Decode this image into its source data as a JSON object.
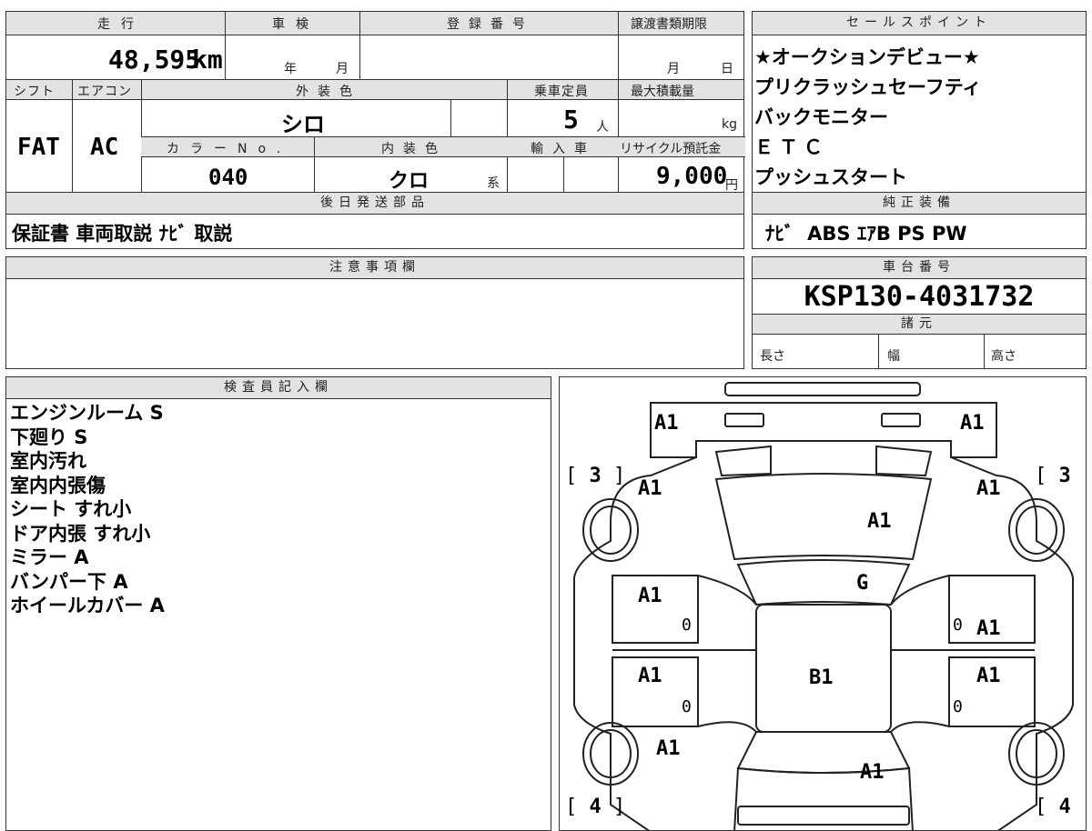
{
  "main": {
    "mileage_label": "走行",
    "mileage_value": "48,595",
    "mileage_unit": "km",
    "inspection_label": "車検",
    "inspection_year": "年",
    "inspection_month": "月",
    "registration_label": "登録番号",
    "transfer_label": "譲渡書類期限",
    "transfer_month": "月",
    "transfer_day": "日",
    "shift_label": "シフト",
    "shift_value": "FAT",
    "ac_label": "エアコン",
    "ac_value": "AC",
    "exterior_color_label": "外装色",
    "exterior_color_value": "シロ",
    "capacity_label": "乗車定員",
    "capacity_value": "5",
    "capacity_unit": "人",
    "max_load_label": "最大積載量",
    "max_load_unit": "kg",
    "color_no_label": "カラーNo.",
    "color_no_value": "040",
    "interior_color_label": "内装色",
    "interior_color_value": "クロ",
    "interior_color_suffix": "系",
    "import_label": "輸入車",
    "recycle_label": "リサイクル預託金",
    "recycle_value": "9,000",
    "recycle_unit": "円",
    "later_parts_label": "後日発送部品",
    "later_parts_value": "保証書 車両取説 ﾅﾋﾞ 取説"
  },
  "sales": {
    "label": "セールスポイント",
    "points": [
      "★オークションデビュー★",
      "プリクラッシュセーフティ",
      "バックモニター",
      "ＥＴＣ",
      "プッシュスタート"
    ]
  },
  "equipment": {
    "label": "純正装備",
    "value": "ﾅﾋﾞ  ABS ｴｱB PS PW"
  },
  "notes": {
    "label": "注意事項欄"
  },
  "chassis": {
    "label": "車台番号",
    "value": "KSP130-4031732",
    "specs_label": "諸元",
    "length": "長さ",
    "width": "幅",
    "height": "高さ"
  },
  "inspector": {
    "label": "検査員記入欄",
    "lines": [
      "エンジンルーム S",
      "下廻り S",
      "室内汚れ",
      "室内内張傷",
      "シート すれ小",
      "ドア内張 すれ小",
      "ミラー A",
      "バンパー下 A",
      "ホイールカバー A"
    ]
  },
  "diagram": {
    "marks": {
      "front_left": "A1",
      "front_right": "A1",
      "fender_left": "A1",
      "fender_right": "A1",
      "hood": "A1",
      "windshield": "G",
      "front_door_left": "A1",
      "front_door_right": "A1",
      "rear_door_left": "A1",
      "rear_door_right": "A1",
      "roof": "B1",
      "quarter_left": "A1",
      "trunk": "A1",
      "zero_1": "0",
      "zero_2": "0",
      "zero_3": "0",
      "zero_4": "0"
    },
    "tire_front_left": "3",
    "tire_front_right": "3",
    "tire_rear_left": "4",
    "tire_rear_right": "4"
  }
}
